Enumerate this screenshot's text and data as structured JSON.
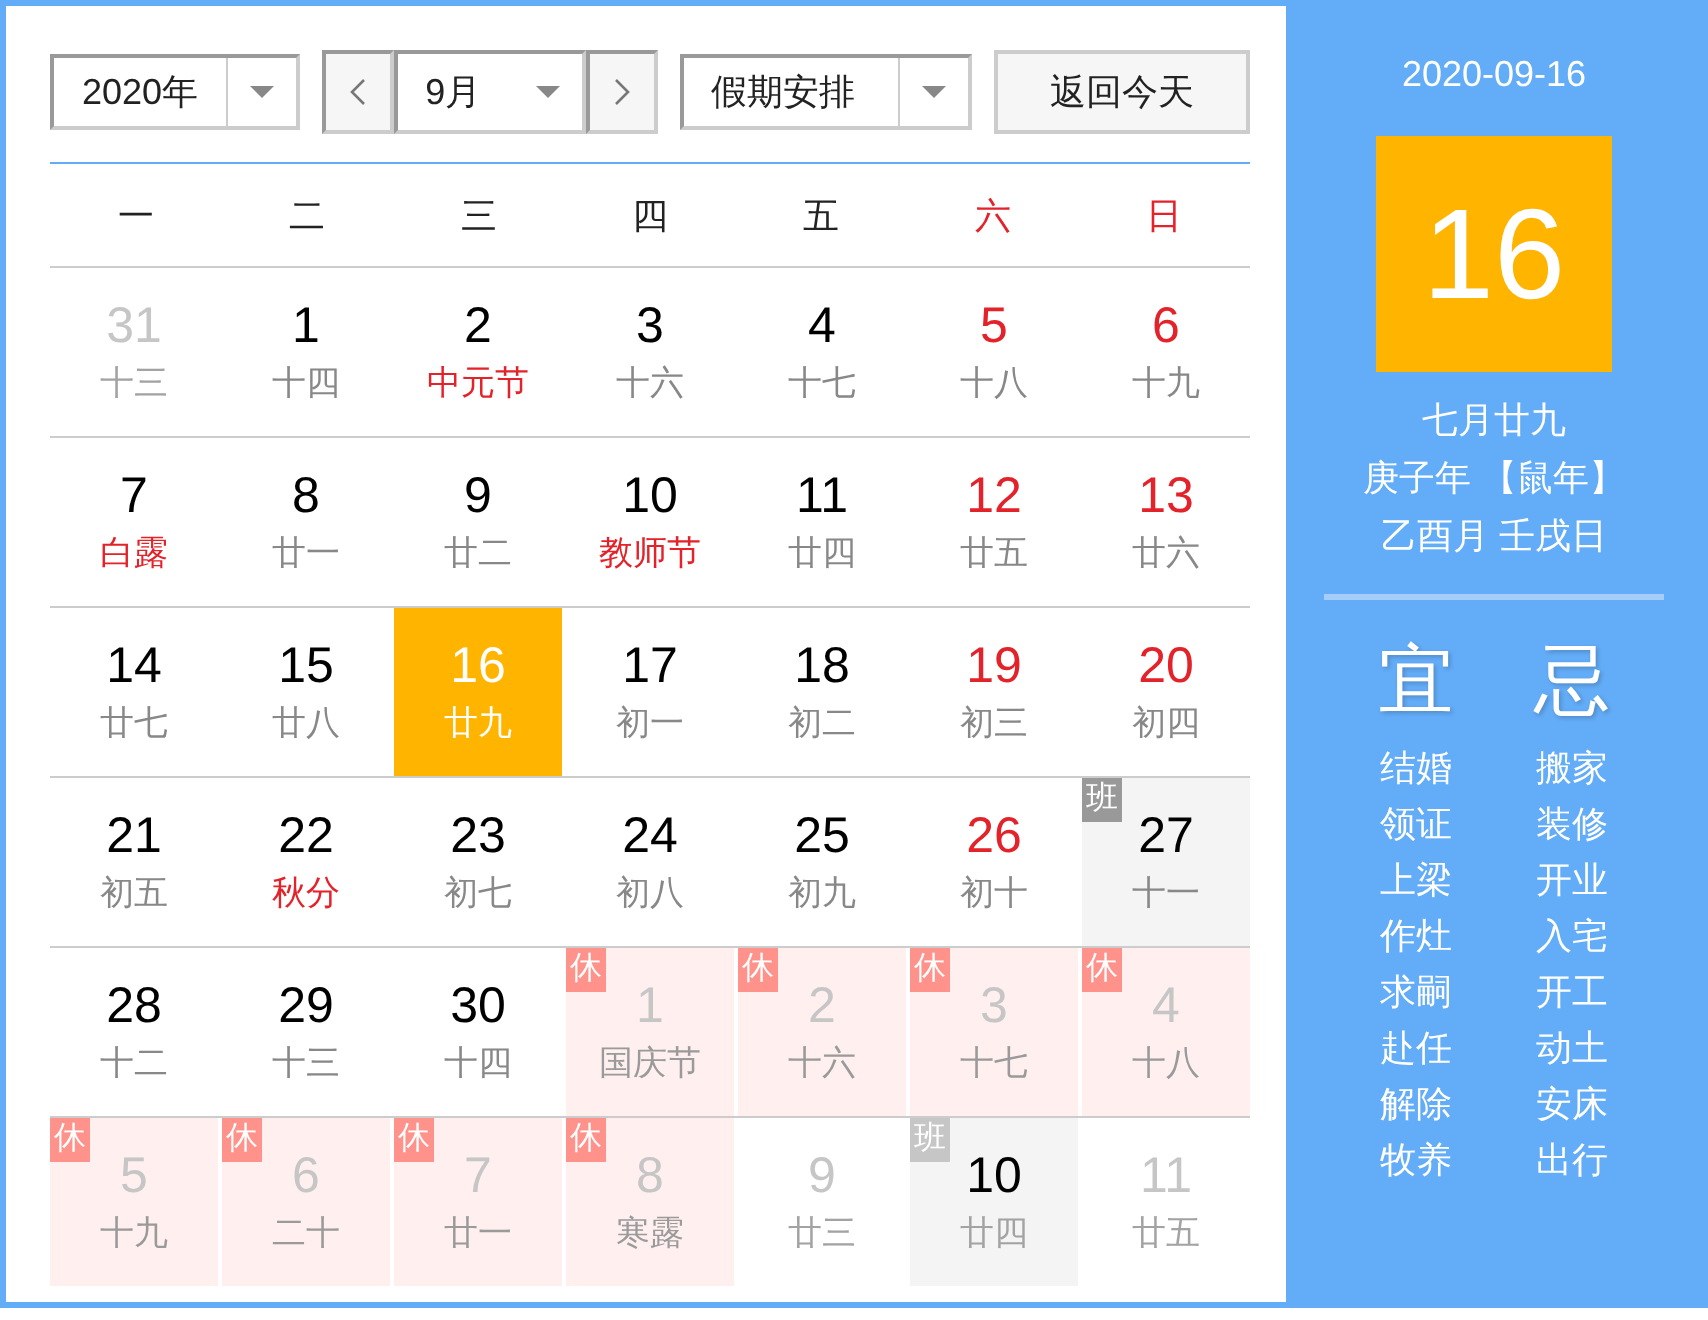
{
  "toolbar": {
    "year": {
      "value": "2020年"
    },
    "month": {
      "value": "9月"
    },
    "holiday": {
      "value": "假期安排"
    },
    "today_button": "返回今天"
  },
  "weekdays": [
    {
      "label": "一",
      "weekend": false
    },
    {
      "label": "二",
      "weekend": false
    },
    {
      "label": "三",
      "weekend": false
    },
    {
      "label": "四",
      "weekend": false
    },
    {
      "label": "五",
      "weekend": false
    },
    {
      "label": "六",
      "weekend": true
    },
    {
      "label": "日",
      "weekend": true
    }
  ],
  "weeks": [
    [
      {
        "day": "31",
        "lunar": "十三",
        "in_month": false,
        "weekend": false,
        "festival": false,
        "selected": false
      },
      {
        "day": "1",
        "lunar": "十四",
        "in_month": true,
        "weekend": false,
        "festival": false,
        "selected": false
      },
      {
        "day": "2",
        "lunar": "中元节",
        "in_month": true,
        "weekend": false,
        "festival": true,
        "selected": false
      },
      {
        "day": "3",
        "lunar": "十六",
        "in_month": true,
        "weekend": false,
        "festival": false,
        "selected": false
      },
      {
        "day": "4",
        "lunar": "十七",
        "in_month": true,
        "weekend": false,
        "festival": false,
        "selected": false
      },
      {
        "day": "5",
        "lunar": "十八",
        "in_month": true,
        "weekend": true,
        "festival": false,
        "selected": false
      },
      {
        "day": "6",
        "lunar": "十九",
        "in_month": true,
        "weekend": true,
        "festival": false,
        "selected": false
      }
    ],
    [
      {
        "day": "7",
        "lunar": "白露",
        "in_month": true,
        "weekend": false,
        "festival": true,
        "selected": false
      },
      {
        "day": "8",
        "lunar": "廿一",
        "in_month": true,
        "weekend": false,
        "festival": false,
        "selected": false
      },
      {
        "day": "9",
        "lunar": "廿二",
        "in_month": true,
        "weekend": false,
        "festival": false,
        "selected": false
      },
      {
        "day": "10",
        "lunar": "教师节",
        "in_month": true,
        "weekend": false,
        "festival": true,
        "selected": false
      },
      {
        "day": "11",
        "lunar": "廿四",
        "in_month": true,
        "weekend": false,
        "festival": false,
        "selected": false
      },
      {
        "day": "12",
        "lunar": "廿五",
        "in_month": true,
        "weekend": true,
        "festival": false,
        "selected": false
      },
      {
        "day": "13",
        "lunar": "廿六",
        "in_month": true,
        "weekend": true,
        "festival": false,
        "selected": false
      }
    ],
    [
      {
        "day": "14",
        "lunar": "廿七",
        "in_month": true,
        "weekend": false,
        "festival": false,
        "selected": false
      },
      {
        "day": "15",
        "lunar": "廿八",
        "in_month": true,
        "weekend": false,
        "festival": false,
        "selected": false
      },
      {
        "day": "16",
        "lunar": "廿九",
        "in_month": true,
        "weekend": false,
        "festival": false,
        "selected": true
      },
      {
        "day": "17",
        "lunar": "初一",
        "in_month": true,
        "weekend": false,
        "festival": false,
        "selected": false
      },
      {
        "day": "18",
        "lunar": "初二",
        "in_month": true,
        "weekend": false,
        "festival": false,
        "selected": false
      },
      {
        "day": "19",
        "lunar": "初三",
        "in_month": true,
        "weekend": true,
        "festival": false,
        "selected": false
      },
      {
        "day": "20",
        "lunar": "初四",
        "in_month": true,
        "weekend": true,
        "festival": false,
        "selected": false
      }
    ],
    [
      {
        "day": "21",
        "lunar": "初五",
        "in_month": true,
        "weekend": false,
        "festival": false,
        "selected": false
      },
      {
        "day": "22",
        "lunar": "秋分",
        "in_month": true,
        "weekend": false,
        "festival": true,
        "selected": false
      },
      {
        "day": "23",
        "lunar": "初七",
        "in_month": true,
        "weekend": false,
        "festival": false,
        "selected": false
      },
      {
        "day": "24",
        "lunar": "初八",
        "in_month": true,
        "weekend": false,
        "festival": false,
        "selected": false
      },
      {
        "day": "25",
        "lunar": "初九",
        "in_month": true,
        "weekend": false,
        "festival": false,
        "selected": false
      },
      {
        "day": "26",
        "lunar": "初十",
        "in_month": true,
        "weekend": true,
        "festival": false,
        "selected": false
      },
      {
        "day": "27",
        "lunar": "十一",
        "in_month": true,
        "weekend": false,
        "festival": false,
        "selected": false,
        "badge": {
          "kind": "work",
          "text": "班"
        }
      }
    ],
    [
      {
        "day": "28",
        "lunar": "十二",
        "in_month": true,
        "weekend": false,
        "festival": false,
        "selected": false
      },
      {
        "day": "29",
        "lunar": "十三",
        "in_month": true,
        "weekend": false,
        "festival": false,
        "selected": false
      },
      {
        "day": "30",
        "lunar": "十四",
        "in_month": true,
        "weekend": false,
        "festival": false,
        "selected": false
      },
      {
        "day": "1",
        "lunar": "国庆节",
        "in_month": false,
        "weekend": false,
        "festival": false,
        "selected": false,
        "badge": {
          "kind": "rest",
          "text": "休"
        }
      },
      {
        "day": "2",
        "lunar": "十六",
        "in_month": false,
        "weekend": false,
        "festival": false,
        "selected": false,
        "badge": {
          "kind": "rest",
          "text": "休"
        }
      },
      {
        "day": "3",
        "lunar": "十七",
        "in_month": false,
        "weekend": false,
        "festival": false,
        "selected": false,
        "badge": {
          "kind": "rest",
          "text": "休"
        }
      },
      {
        "day": "4",
        "lunar": "十八",
        "in_month": false,
        "weekend": false,
        "festival": false,
        "selected": false,
        "badge": {
          "kind": "rest",
          "text": "休"
        }
      }
    ],
    [
      {
        "day": "5",
        "lunar": "十九",
        "in_month": false,
        "weekend": false,
        "festival": false,
        "selected": false,
        "badge": {
          "kind": "rest",
          "text": "休"
        }
      },
      {
        "day": "6",
        "lunar": "二十",
        "in_month": false,
        "weekend": false,
        "festival": false,
        "selected": false,
        "badge": {
          "kind": "rest",
          "text": "休"
        }
      },
      {
        "day": "7",
        "lunar": "廿一",
        "in_month": false,
        "weekend": false,
        "festival": false,
        "selected": false,
        "badge": {
          "kind": "rest",
          "text": "休"
        }
      },
      {
        "day": "8",
        "lunar": "寒露",
        "in_month": false,
        "weekend": false,
        "festival": false,
        "selected": false,
        "badge": {
          "kind": "rest",
          "text": "休"
        }
      },
      {
        "day": "9",
        "lunar": "廿三",
        "in_month": false,
        "weekend": false,
        "festival": false,
        "selected": false
      },
      {
        "day": "10",
        "lunar": "廿四",
        "in_month": false,
        "weekend": false,
        "festival": false,
        "selected": false,
        "badge": {
          "kind": "work",
          "text": "班"
        }
      },
      {
        "day": "11",
        "lunar": "廿五",
        "in_month": false,
        "weekend": false,
        "festival": false,
        "selected": false
      }
    ]
  ],
  "side": {
    "date": "2020-09-16",
    "big_day": "16",
    "lunar_date": "七月廿九",
    "year_line": "庚子年 【鼠年】",
    "ganzhi": "乙酉月 壬戌日",
    "good": {
      "title": "宜",
      "items": [
        "结婚",
        "领证",
        "上梁",
        "作灶",
        "求嗣",
        "赴任",
        "解除",
        "牧养"
      ]
    },
    "bad": {
      "title": "忌",
      "items": [
        "搬家",
        "装修",
        "开业",
        "入宅",
        "开工",
        "动土",
        "安床",
        "出行"
      ]
    }
  }
}
